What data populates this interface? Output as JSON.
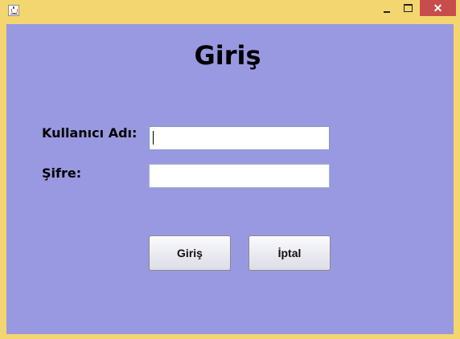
{
  "window": {
    "controls": {
      "minimize_icon": "minimize-icon",
      "maximize_icon": "maximize-icon",
      "close_icon": "close-icon",
      "close_glyph": "✕"
    }
  },
  "form": {
    "title": "Giriş",
    "username_label": "Kullanıcı Adı:",
    "username_value": "",
    "password_label": "Şifre:",
    "password_value": ""
  },
  "buttons": {
    "login_label": "Giriş",
    "cancel_label": "İptal"
  },
  "colors": {
    "window_frame": "#f3d66f",
    "content_background": "#9999e1",
    "close_button": "#c74d4d"
  }
}
